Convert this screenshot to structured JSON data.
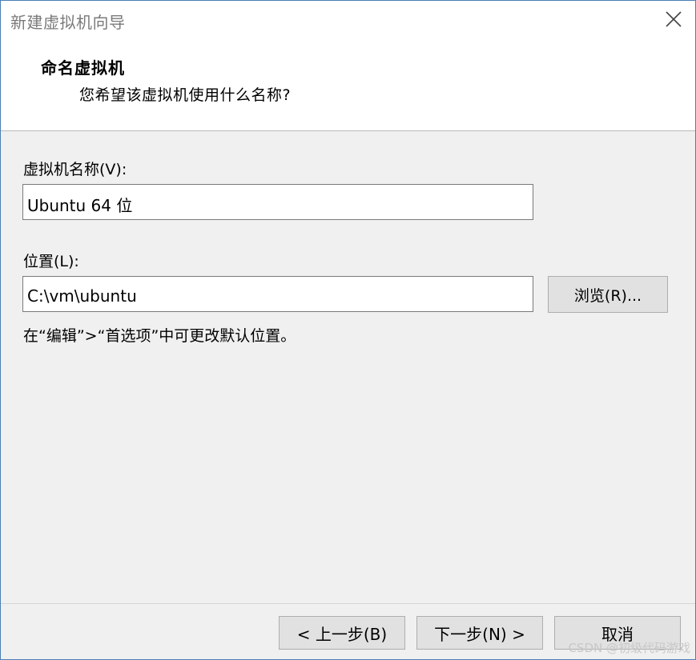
{
  "window": {
    "title": "新建虚拟机向导"
  },
  "header": {
    "title": "命名虚拟机",
    "subtitle": "您希望该虚拟机使用什么名称?"
  },
  "form": {
    "name_label": "虚拟机名称(V):",
    "name_value": "Ubuntu 64 位",
    "location_label": "位置(L):",
    "location_value": "C:\\vm\\ubuntu",
    "browse_label": "浏览(R)...",
    "hint": "在“编辑”>“首选项”中可更改默认位置。"
  },
  "footer": {
    "back_label": "< 上一步(B)",
    "next_label": "下一步(N) >",
    "cancel_label": "取消"
  },
  "watermark": "CSDN @初级代码游戏",
  "icons": {
    "close": "close-icon"
  },
  "colors": {
    "window_border": "#4a7fb5",
    "title_text": "#7a7a7a",
    "content_bg": "#f0f0f0",
    "button_bg": "#e1e1e1"
  }
}
